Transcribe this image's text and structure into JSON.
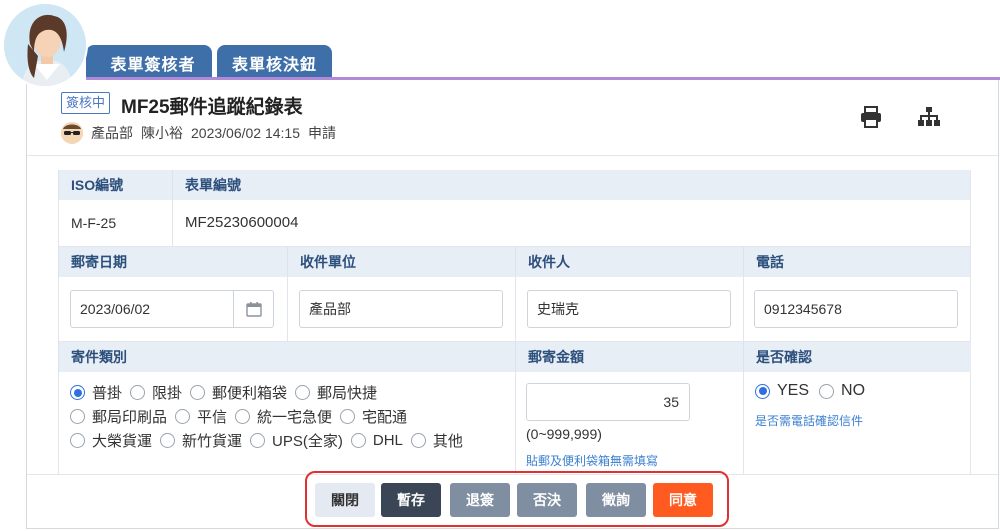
{
  "tabs": {
    "approver": "表單簽核者",
    "decision": "表單核決鈕"
  },
  "header": {
    "status": "簽核中",
    "title": "MF25郵件追蹤紀錄表",
    "department": "產品部",
    "applicant": "陳小裕",
    "datetime": "2023/06/02 14:15",
    "action": "申請"
  },
  "form": {
    "iso_label": "ISO編號",
    "form_no_label": "表單編號",
    "iso_value": "M-F-25",
    "form_no_value": "MF25230600004",
    "mail_date_label": "郵寄日期",
    "mail_date_value": "2023/06/02",
    "recv_unit_label": "收件單位",
    "recv_unit_value": "產品部",
    "recipient_label": "收件人",
    "recipient_value": "史瑞克",
    "phone_label": "電話",
    "phone_value": "0912345678",
    "mail_type_label": "寄件類別",
    "mail_types_row1": [
      "普掛",
      "限掛",
      "郵便利箱袋",
      "郵局快捷"
    ],
    "mail_types_row2": [
      "郵局印刷品",
      "平信",
      "統一宅急便",
      "宅配通"
    ],
    "mail_types_row3": [
      "大榮貨運",
      "新竹貨運",
      "UPS(全家)",
      "DHL",
      "其他"
    ],
    "amount_label": "郵寄金額",
    "amount_value": "35",
    "amount_range": "(0~999,999)",
    "amount_hint": "貼郵及便利袋箱無需填寫",
    "confirm_label": "是否確認",
    "confirm_yes": "YES",
    "confirm_no": "NO",
    "confirm_hint": "是否需電話確認信件"
  },
  "buttons": {
    "close": "關閉",
    "save": "暫存",
    "return": "退簽",
    "reject": "否決",
    "consult": "徵詢",
    "approve": "同意"
  },
  "colors": {
    "tab": "#3f6fa8",
    "accent_line": "#b08ad8",
    "approve": "#ff5a1f",
    "highlight_border": "#e03131"
  }
}
